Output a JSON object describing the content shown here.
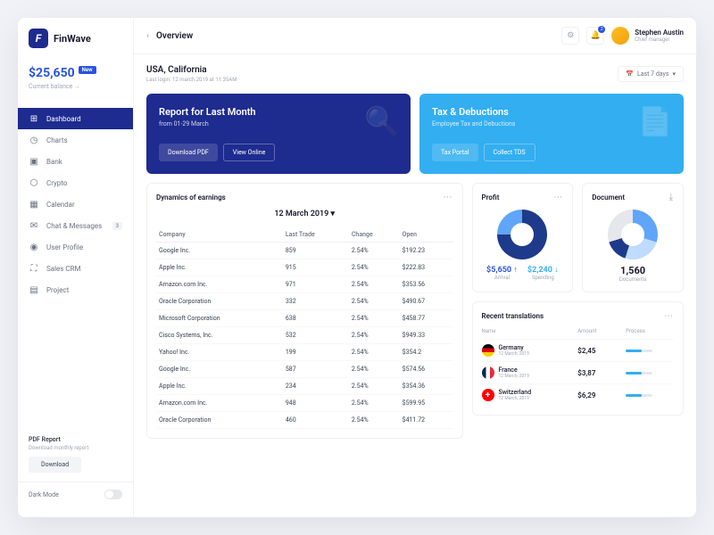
{
  "brand": "FinWave",
  "balance": {
    "amount": "$25,650",
    "badge": "New",
    "label": "Current balance →"
  },
  "nav": [
    {
      "icon": "⊞",
      "label": "Dashboard",
      "active": true
    },
    {
      "icon": "◷",
      "label": "Charts"
    },
    {
      "icon": "▣",
      "label": "Bank"
    },
    {
      "icon": "⬡",
      "label": "Crypto"
    },
    {
      "icon": "▦",
      "label": "Calendar"
    },
    {
      "icon": "✉",
      "label": "Chat & Messages",
      "badge": "3"
    },
    {
      "icon": "◉",
      "label": "User Profile"
    },
    {
      "icon": "⛶",
      "label": "Sales CRM"
    },
    {
      "icon": "▤",
      "label": "Project"
    }
  ],
  "pdf": {
    "title": "PDF Report",
    "sub": "Download monthly report",
    "btn": "Download"
  },
  "darkmode": "Dark Mode",
  "topbar": {
    "title": "Overview",
    "notif": "2",
    "user_name": "Stephen Austin",
    "user_role": "Chief manager"
  },
  "location": {
    "place": "USA, California",
    "login": "Last login: 12 march 2019 at 11:35AM",
    "range": "Last 7 days"
  },
  "card1": {
    "title": "Report for Last Month",
    "sub": "from 01-29 March",
    "btn1": "Download PDF",
    "btn2": "View Online"
  },
  "card2": {
    "title": "Tax & Debuctions",
    "sub": "Employee Tax and Debuctions",
    "btn1": "Tax Portal",
    "btn2": "Collect TDS"
  },
  "earnings": {
    "title": "Dynamics of earnings",
    "date": "12 March 2019 ▾",
    "headers": [
      "Company",
      "Last Trade",
      "Change",
      "Open"
    ],
    "rows": [
      [
        "Google Inc.",
        "859",
        "2.54%",
        "$192.23"
      ],
      [
        "Apple Inc.",
        "915",
        "2.54%",
        "$222.83"
      ],
      [
        "Amazon.com Inc.",
        "971",
        "2.54%",
        "$353.56"
      ],
      [
        "Oracle Corporation",
        "332",
        "2.54%",
        "$490.67"
      ],
      [
        "Microsoft Corporation",
        "638",
        "2.54%",
        "$458.77"
      ],
      [
        "Cisco Systems, Inc.",
        "532",
        "2.54%",
        "$949.33"
      ],
      [
        "Yahoo! Inc.",
        "199",
        "2.54%",
        "$354.2"
      ],
      [
        "Google Inc.",
        "587",
        "2.54%",
        "$574.56"
      ],
      [
        "Apple Inc.",
        "234",
        "2.54%",
        "$354.36"
      ],
      [
        "Amazon.com Inc.",
        "948",
        "2.54%",
        "$599.95"
      ],
      [
        "Oracle Corporation",
        "460",
        "2.54%",
        "$411.72"
      ]
    ]
  },
  "profit": {
    "title": "Profit",
    "arrival": "$5,650 ↑",
    "arrival_label": "Arrival",
    "spending": "$2,240 ↓",
    "spending_label": "Spending"
  },
  "document": {
    "title": "Document",
    "count": "1,560",
    "label": "Documents"
  },
  "translations": {
    "title": "Recent translations",
    "headers": [
      "Name",
      "Amount",
      "Process"
    ],
    "rows": [
      {
        "flag": "de",
        "name": "Germany",
        "date": "12 March, 2019",
        "amount": "$2,45"
      },
      {
        "flag": "fr",
        "name": "France",
        "date": "12 March, 2019",
        "amount": "$3,87"
      },
      {
        "flag": "ch",
        "name": "Switzerland",
        "date": "12 March, 2019",
        "amount": "$6,29"
      }
    ]
  },
  "chart_data": [
    {
      "type": "pie",
      "title": "Profit",
      "series": [
        {
          "name": "Arrival",
          "value": 5650
        },
        {
          "name": "Spending",
          "value": 2240
        }
      ]
    },
    {
      "type": "pie",
      "title": "Document",
      "values": [
        30,
        25,
        15,
        30
      ],
      "total": 1560
    }
  ]
}
